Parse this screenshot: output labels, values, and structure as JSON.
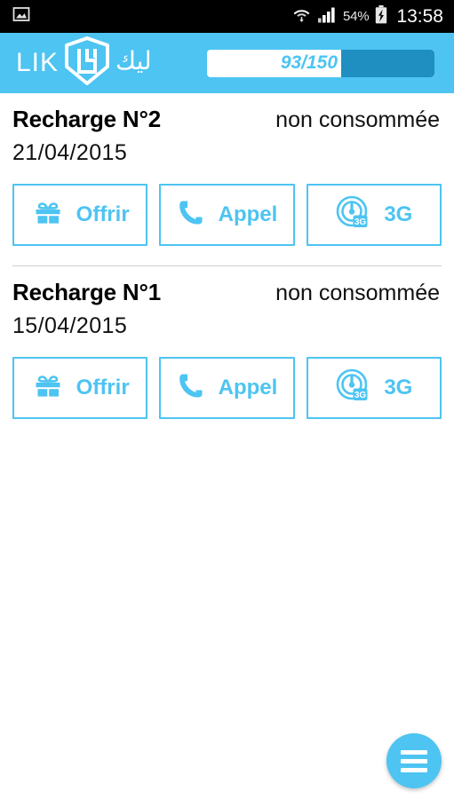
{
  "status_bar": {
    "left_icons": [
      "image-icon"
    ],
    "wifi_icon": "wifi-icon",
    "signal_icon": "cellular-signal-icon",
    "battery_percent": "54%",
    "battery_icon": "battery-charging-icon",
    "clock": "13:58"
  },
  "header": {
    "brand_latin": "LIK",
    "brand_mark": "shield-logo-icon",
    "brand_arabic": "ليك",
    "progress": {
      "label": "93/150",
      "value": 93,
      "max": 150,
      "fill_percent": 41,
      "track_color": "#FFFFFF",
      "fill_color": "#1E8FC0",
      "label_color": "#4DC4F2"
    },
    "background_color": "#4DC4F2"
  },
  "recharges": [
    {
      "title": "Recharge N°2",
      "status": "non consommée",
      "date": "21/04/2015",
      "actions": [
        {
          "label": "Offrir",
          "icon": "gift-icon"
        },
        {
          "label": "Appel",
          "icon": "phone-icon"
        },
        {
          "label": "3G",
          "icon": "3g-signal-icon"
        }
      ]
    },
    {
      "title": "Recharge N°1",
      "status": "non consommée",
      "date": "15/04/2015",
      "actions": [
        {
          "label": "Offrir",
          "icon": "gift-icon"
        },
        {
          "label": "Appel",
          "icon": "phone-icon"
        },
        {
          "label": "3G",
          "icon": "3g-signal-icon"
        }
      ]
    }
  ],
  "fab": {
    "icon": "hamburger-menu-icon",
    "color": "#4DC4F2"
  },
  "theme": {
    "accent": "#4DC4F2",
    "accent_dark": "#1E8FC0",
    "text": "#111111",
    "divider": "#CFCFCF"
  }
}
